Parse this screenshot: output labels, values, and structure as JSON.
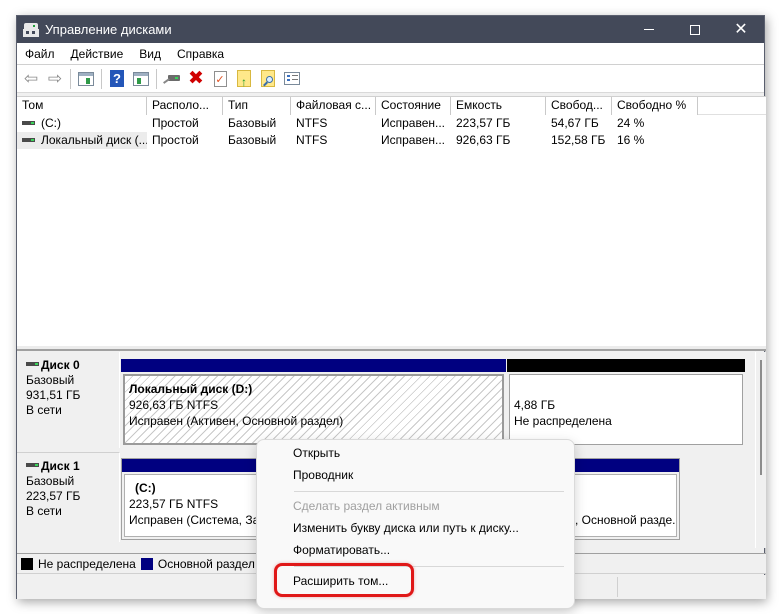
{
  "window": {
    "title": "Управление дисками",
    "controls": {
      "minimize": "minimize",
      "maximize": "maximize",
      "close": "✕"
    }
  },
  "menubar": [
    "Файл",
    "Действие",
    "Вид",
    "Справка"
  ],
  "toolbar": [
    "back-icon",
    "forward-icon",
    "show-hide-console-tree-icon",
    "help-icon",
    "show-hide-action-pane-icon",
    "connect-drive-icon",
    "delete-icon",
    "check-icon",
    "folder-up-icon",
    "folder-search-icon",
    "properties-icon"
  ],
  "volume_table": {
    "columns": [
      "Том",
      "Располо...",
      "Тип",
      "Файловая с...",
      "Состояние",
      "Емкость",
      "Свобод...",
      "Свободно %"
    ],
    "rows": [
      [
        "(C:)",
        "Простой",
        "Базовый",
        "NTFS",
        "Исправен...",
        "223,57 ГБ",
        "54,67 ГБ",
        "24 %"
      ],
      [
        "Локальный диск (...",
        "Простой",
        "Базовый",
        "NTFS",
        "Исправен...",
        "926,63 ГБ",
        "152,58 ГБ",
        "16 %"
      ]
    ]
  },
  "disks": [
    {
      "name": "Диск 0",
      "type": "Базовый",
      "size": "931,51 ГБ",
      "status": "В сети",
      "partitions": [
        {
          "name": "Локальный диск  (D:)",
          "size_fs": "926,63 ГБ NTFS",
          "status": "Исправен (Активен, Основной раздел)",
          "kind": "primary",
          "bar_color": "#000080",
          "selected": true
        },
        {
          "name": "",
          "size_fs": "4,88 ГБ",
          "status": "Не распределена",
          "kind": "unallocated",
          "bar_color": "#000000",
          "selected": false
        }
      ]
    },
    {
      "name": "Диск 1",
      "type": "Базовый",
      "size": "223,57 ГБ",
      "status": "В сети",
      "partitions": [
        {
          "name": "(C:)",
          "size_fs": "223,57 ГБ NTFS",
          "status": "Исправен (Система, За",
          "status_tail": ", Основной разде.",
          "kind": "primary",
          "bar_color": "#000080",
          "selected": false
        }
      ]
    }
  ],
  "legend": [
    {
      "label": "Не распределена",
      "color": "#000000"
    },
    {
      "label": "Основной раздел",
      "color": "#000080"
    }
  ],
  "context_menu": {
    "items": [
      {
        "label": "Открыть",
        "enabled": true
      },
      {
        "label": "Проводник",
        "enabled": true
      },
      {
        "label": "Сделать раздел активным",
        "enabled": false
      },
      {
        "label": "Изменить букву диска или путь к диску...",
        "enabled": true
      },
      {
        "label": "Форматировать...",
        "enabled": true
      },
      {
        "label": "Расширить том...",
        "enabled": true,
        "highlighted": true
      }
    ],
    "highlight_color": "#e01818"
  }
}
